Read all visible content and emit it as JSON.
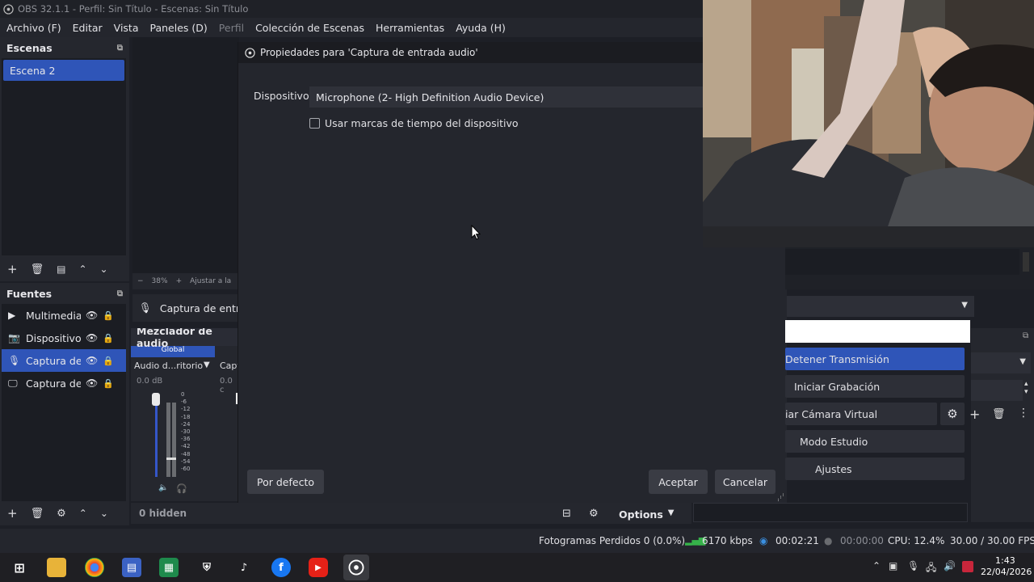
{
  "window": {
    "title": "OBS 32.1.1 - Perfil: Sin Título - Escenas: Sin Título"
  },
  "menu": {
    "items": [
      {
        "label": "Archivo (F)",
        "disabled": false
      },
      {
        "label": "Editar",
        "disabled": false
      },
      {
        "label": "Vista",
        "disabled": false
      },
      {
        "label": "Paneles (D)",
        "disabled": false
      },
      {
        "label": "Perfil",
        "disabled": true
      },
      {
        "label": "Colección de Escenas",
        "disabled": false
      },
      {
        "label": "Herramientas",
        "disabled": false
      },
      {
        "label": "Ayuda (H)",
        "disabled": false
      }
    ]
  },
  "scenes": {
    "title": "Escenas",
    "items": [
      "Escena 2"
    ]
  },
  "sources": {
    "title": "Fuentes",
    "items": [
      {
        "label": "Multimedia",
        "icon": "play-icon"
      },
      {
        "label": "Dispositivo c",
        "icon": "camera-icon"
      },
      {
        "label": "Captura de e",
        "icon": "microphone-icon"
      },
      {
        "label": "Captura de p",
        "icon": "monitor-icon"
      }
    ],
    "hidden_label": "0 hidden"
  },
  "preview": {
    "zoom_label": "38%",
    "fit_label": "Ajustar a la",
    "selected_source": "Captura de entrad"
  },
  "mixer": {
    "title": "Mezclador de audio",
    "global_label": "Global",
    "channels": [
      {
        "name": "Audio d...ritorio",
        "db": "0.0 dB"
      },
      {
        "name": "Captu",
        "db": "0.0 c"
      }
    ],
    "scale": [
      "0",
      "-6",
      "-12",
      "-18",
      "-24",
      "-30",
      "-36",
      "-42",
      "-48",
      "-54",
      "-60"
    ],
    "options_label": "Options"
  },
  "dialog": {
    "title": "Propiedades para 'Captura de entrada audio'",
    "device_label": "Dispositivo",
    "device_value": "Microphone (2- High Definition Audio Device)",
    "timestamp_label": "Usar marcas de tiempo del dispositivo",
    "defaults_button": "Por defecto",
    "accept_button": "Aceptar",
    "cancel_button": "Cancelar"
  },
  "controls": {
    "stop_stream": "Detener Transmisión",
    "start_record": "Iniciar Grabación",
    "virtual_cam": "iar Cámara Virtual",
    "studio_mode": "Modo Estudio",
    "settings": "Ajustes"
  },
  "status": {
    "dropped_frames": "Fotogramas Perdidos 0 (0.0%)",
    "bitrate": "6170 kbps",
    "stream_time": "00:02:21",
    "record_time": "00:00:00",
    "cpu": "CPU: 12.4%",
    "fps": "30.00 / 30.00 FPS"
  },
  "taskbar": {
    "time": "1:43",
    "date": "22/04/2026"
  },
  "colors": {
    "accent": "#2f55b8",
    "panel": "#25272e",
    "dark": "#1b1d23",
    "meter_blue": "#3556c8"
  }
}
